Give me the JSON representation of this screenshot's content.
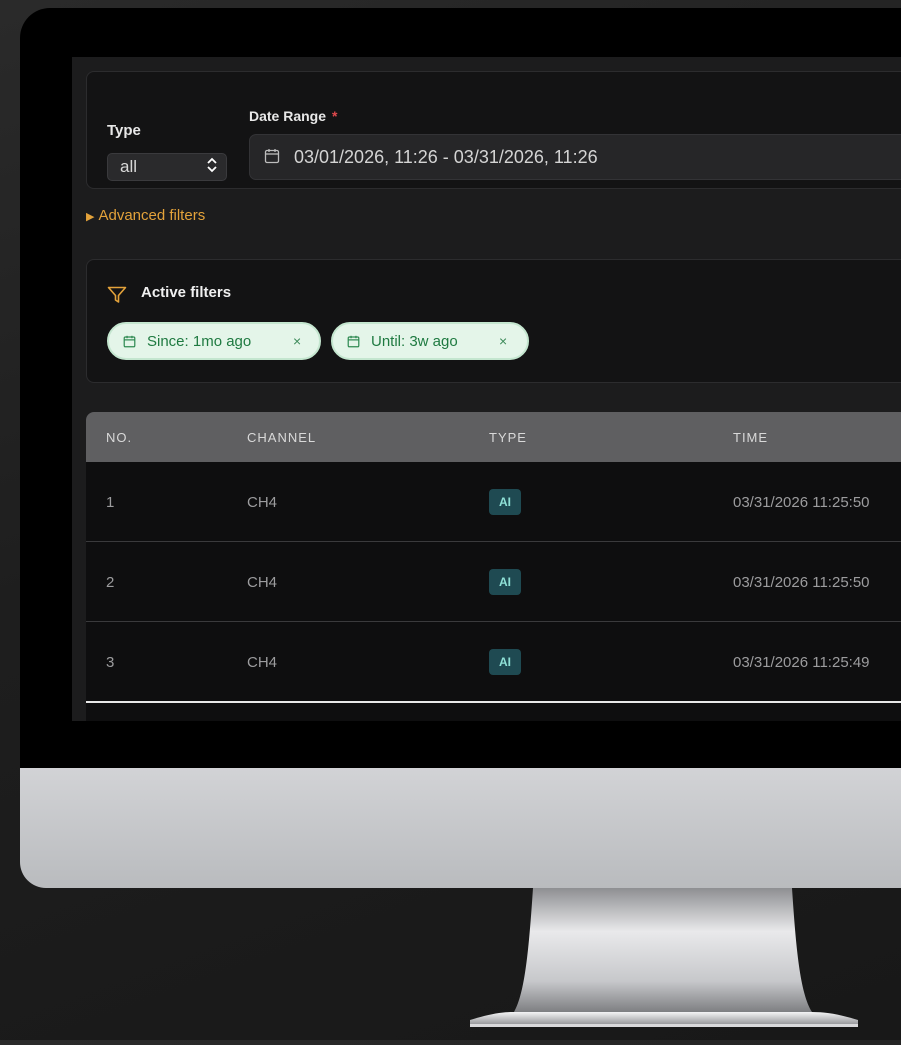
{
  "filters": {
    "type_label": "Type",
    "type_value": "all",
    "date_range_label": "Date Range",
    "required_mark": "*",
    "date_range_value": "03/01/2026, 11:26 - 03/31/2026, 11:26",
    "advanced_filters_label": "Advanced filters"
  },
  "active_filters": {
    "title": "Active filters",
    "chips": [
      {
        "label": "Since: 1mo ago",
        "remove": "×"
      },
      {
        "label": "Until: 3w ago",
        "remove": "×"
      }
    ]
  },
  "table": {
    "columns": [
      "NO.",
      "CHANNEL",
      "TYPE",
      "TIME"
    ],
    "rows": [
      {
        "no": "1",
        "channel": "CH4",
        "type": "AI",
        "time": "03/31/2026 11:25:50"
      },
      {
        "no": "2",
        "channel": "CH4",
        "type": "AI",
        "time": "03/31/2026 11:25:50"
      },
      {
        "no": "3",
        "channel": "CH4",
        "type": "AI",
        "time": "03/31/2026 11:25:49"
      }
    ]
  },
  "icons": {
    "calendar": "calendar-icon",
    "funnel": "funnel-icon",
    "select_chevron": "chevron-up-down-icon",
    "disclosure": "triangle-right-icon"
  },
  "colors": {
    "accent_orange": "#e3a23a",
    "required_red": "#e0494d",
    "chip_bg": "#e4f5e9",
    "chip_text": "#1f7a41",
    "badge_bg": "#1f4a52",
    "badge_text": "#8fe0d6"
  }
}
